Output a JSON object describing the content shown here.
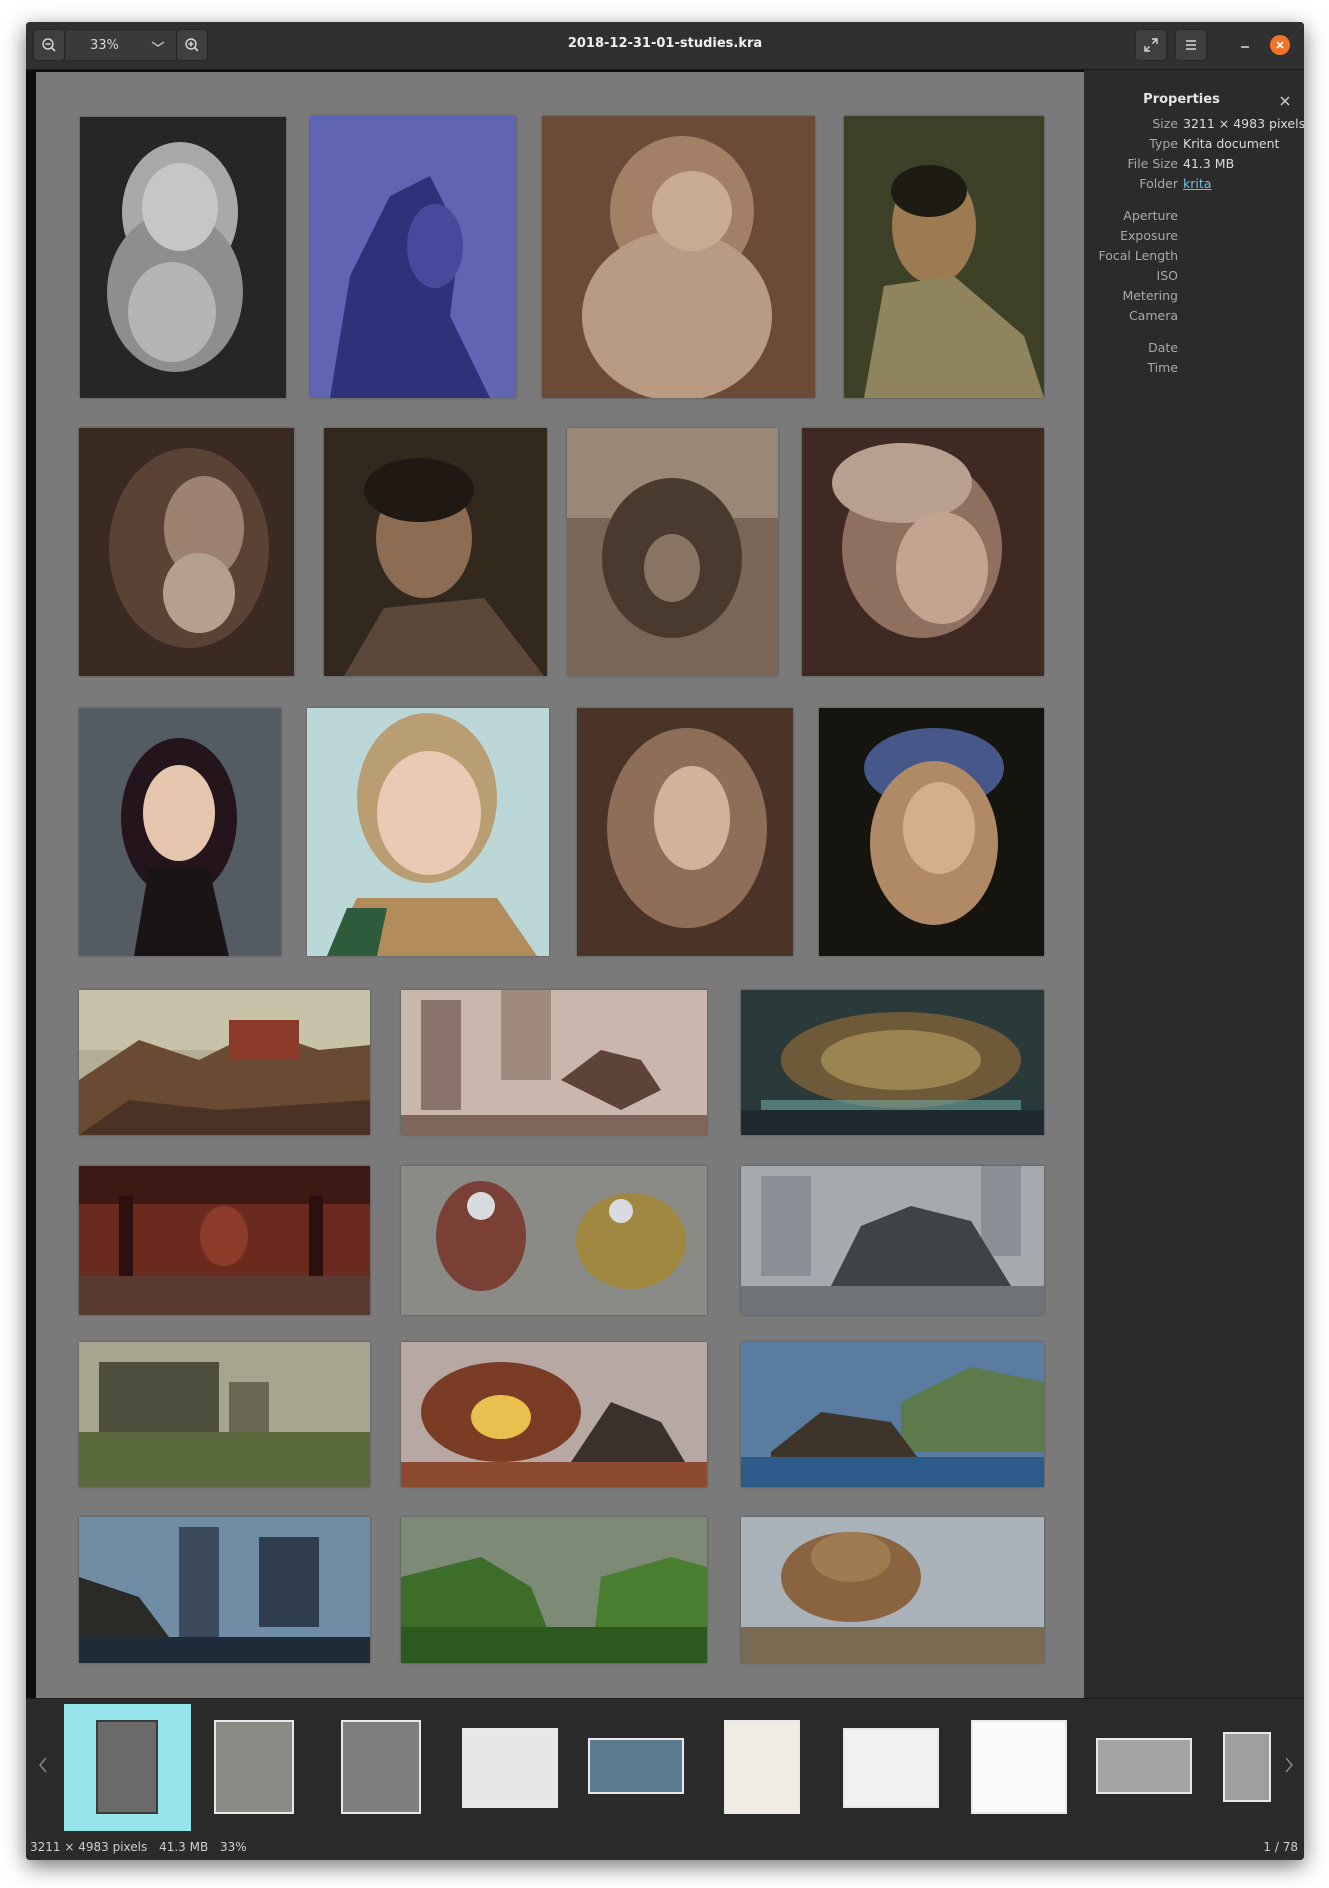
{
  "window": {
    "title": "2018-12-31-01-studies.kra",
    "zoom": "33%"
  },
  "properties": {
    "title": "Properties",
    "rows": [
      {
        "label": "Size",
        "value": "3211 × 4983 pixels"
      },
      {
        "label": "Type",
        "value": "Krita document"
      },
      {
        "label": "File Size",
        "value": "41.3 MB"
      },
      {
        "label": "Folder",
        "value": "krita"
      },
      {
        "label": "Aperture",
        "value": ""
      },
      {
        "label": "Exposure",
        "value": ""
      },
      {
        "label": "Focal Length",
        "value": ""
      },
      {
        "label": "ISO",
        "value": ""
      },
      {
        "label": "Metering",
        "value": ""
      },
      {
        "label": "Camera",
        "value": ""
      },
      {
        "label": "Date",
        "value": ""
      },
      {
        "label": "Time",
        "value": ""
      }
    ]
  },
  "statusbar": {
    "dimensions": "3211 × 4983 pixels",
    "filesize": "41.3 MB",
    "zoom": "33%",
    "position": "1 / 78"
  },
  "colors": {
    "accent_selection": "#96e5ea",
    "close_button": "#f37329",
    "link": "#6cc3e0"
  },
  "icons": {
    "zoom_out": "zoom-out-icon",
    "zoom_in": "zoom-in-icon",
    "fullscreen": "fullscreen-icon",
    "menu": "menu-icon",
    "minimize": "minimize-icon",
    "close": "close-icon"
  }
}
